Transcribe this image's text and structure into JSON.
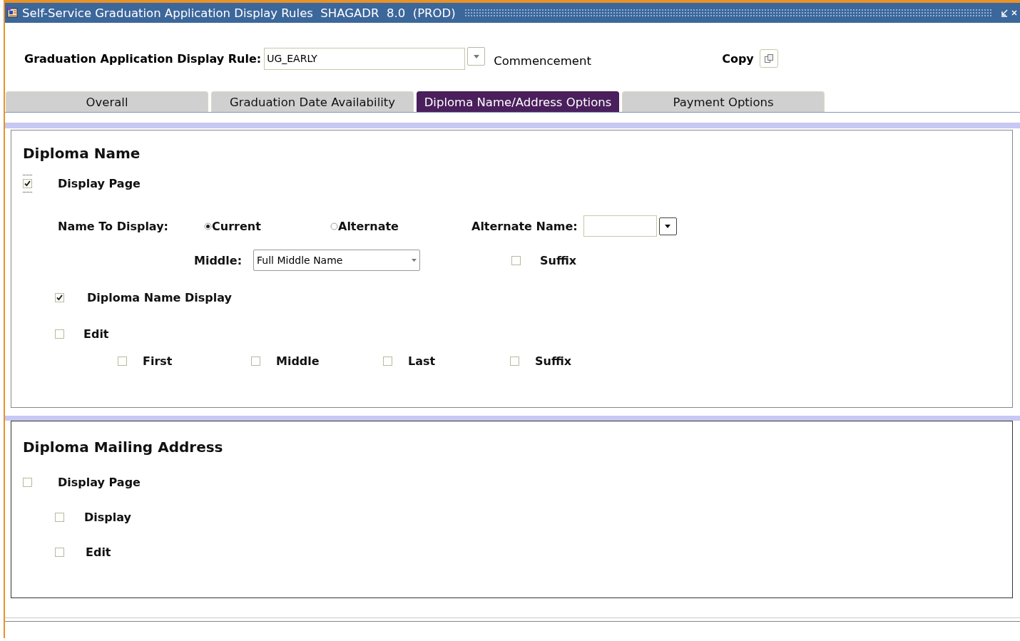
{
  "window": {
    "title": "Self-Service Graduation Application Display Rules  SHAGADR  8.0  (PROD)"
  },
  "key_block": {
    "label": "Graduation Application Display Rule:",
    "value": "UG_EARLY",
    "description": "Commencement",
    "copy_label": "Copy"
  },
  "tabs": [
    {
      "label": "Overall",
      "selected": false
    },
    {
      "label": "Graduation Date Availability",
      "selected": false
    },
    {
      "label": "Diploma Name/Address Options",
      "selected": true
    },
    {
      "label": "Payment Options",
      "selected": false
    }
  ],
  "diploma_name": {
    "title": "Diploma Name",
    "display_page": {
      "label": "Display Page",
      "checked": true
    },
    "name_to_display": {
      "label": "Name To Display:",
      "options": [
        {
          "label": "Current",
          "selected": true
        },
        {
          "label": "Alternate",
          "selected": false
        }
      ]
    },
    "alternate_name": {
      "label": "Alternate Name:"
    },
    "middle": {
      "label": "Middle:",
      "value": "Full Middle Name"
    },
    "suffix": {
      "label": "Suffix",
      "checked": false
    },
    "diploma_name_display": {
      "label": "Diploma Name Display",
      "checked": true
    },
    "edit": {
      "label": "Edit",
      "checked": false
    },
    "edit_parts": [
      {
        "label": "First",
        "checked": false
      },
      {
        "label": "Middle",
        "checked": false
      },
      {
        "label": "Last",
        "checked": false
      },
      {
        "label": "Suffix",
        "checked": false
      }
    ]
  },
  "diploma_mailing_address": {
    "title": "Diploma Mailing Address",
    "display_page": {
      "label": "Display Page",
      "checked": false
    },
    "display": {
      "label": "Display",
      "checked": false
    },
    "edit": {
      "label": "Edit",
      "checked": false
    }
  }
}
